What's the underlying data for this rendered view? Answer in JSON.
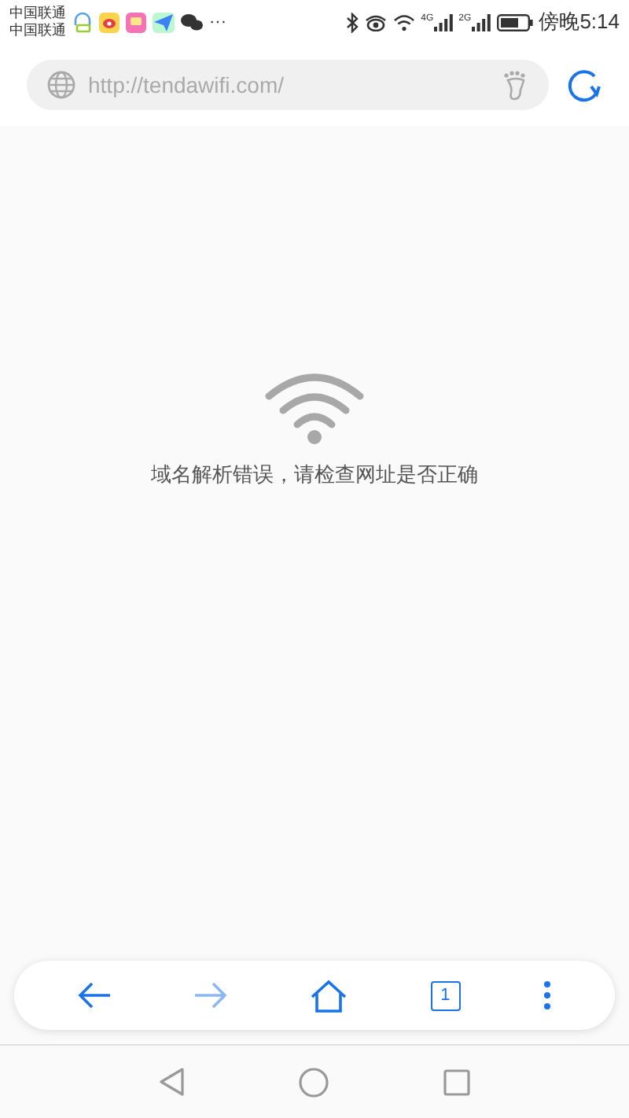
{
  "status_bar": {
    "carriers": [
      "中国联通",
      "中国联通"
    ],
    "more": "···",
    "networks": [
      {
        "label": "4G"
      },
      {
        "label": "2G"
      }
    ],
    "time": "傍晚5:14"
  },
  "address_bar": {
    "url": "http://tendawifi.com/"
  },
  "error": {
    "message": "域名解析错误，请检查网址是否正确"
  },
  "toolbar": [
    {
      "kind": "back",
      "disabled": false
    },
    {
      "kind": "forward",
      "disabled": true
    },
    {
      "kind": "home",
      "disabled": false
    },
    {
      "kind": "tabs",
      "disabled": false,
      "count": "1"
    },
    {
      "kind": "menu",
      "disabled": false
    }
  ],
  "nav_bar": [
    {
      "kind": "back"
    },
    {
      "kind": "home"
    },
    {
      "kind": "recents"
    }
  ]
}
